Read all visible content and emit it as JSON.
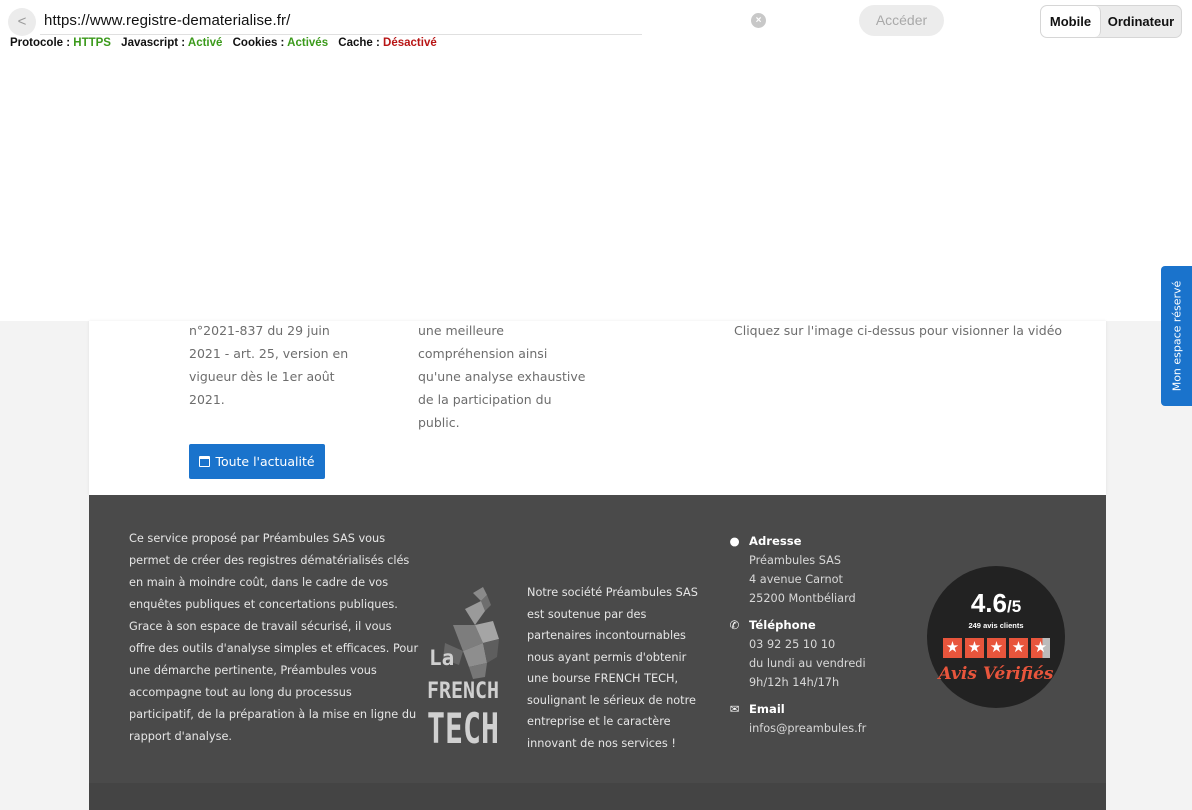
{
  "browser": {
    "back_label": "<",
    "url": "https://www.registre-dematerialise.fr/",
    "clear_label": "×",
    "go_label": "Accéder",
    "mode_mobile": "Mobile",
    "mode_desktop": "Ordinateur",
    "status": {
      "protocol_label": "Protocole :",
      "protocol_value": "HTTPS",
      "js_label": "Javascript :",
      "js_value": "Activé",
      "cookies_label": "Cookies :",
      "cookies_value": "Activés",
      "cache_label": "Cache :",
      "cache_value": "Désactivé"
    }
  },
  "content": {
    "col1_text": "n°2021-837 du 29 juin 2021 - art. 25, version en vigueur dès le 1er août 2021.",
    "col2_text": "une meilleure compréhension ainsi qu'une analyse exhaustive de la participation du public.",
    "video_caption": "Cliquez sur l'image ci-dessus pour visionner la vidéo",
    "news_button": "Toute l'actualité",
    "side_tab": "Mon espace réservé"
  },
  "footer": {
    "about": "Ce service proposé par Préambules SAS vous permet de créer des registres dématérialisés clés en main à moindre coût, dans le cadre de vos enquêtes publiques et concertations publiques. Grace à son espace de travail sécurisé, il vous offre des outils d'analyse simples et efficaces. Pour une démarche pertinente, Préambules vous accompagne tout au long du processus participatif, de la préparation à la mise en ligne du rapport d'analyse.",
    "frenchtech": {
      "line1": "La",
      "line2": "FRENCH",
      "line3": "TECH"
    },
    "support": "Notre société Préambules SAS est soutenue par des partenaires incontournables nous ayant permis d'obtenir une bourse FRENCH TECH, soulignant le sérieux de notre entreprise et le caractère innovant de nos services !",
    "address": {
      "heading": "Adresse",
      "line1": "Préambules SAS",
      "line2": "4 avenue Carnot",
      "line3": "25200 Montbéliard"
    },
    "phone": {
      "heading": "Téléphone",
      "line1": "03 92 25 10 10",
      "line2": "du lundi au vendredi",
      "line3": "9h/12h 14h/17h"
    },
    "email": {
      "heading": "Email",
      "line1": "infos@preambules.fr"
    },
    "rating": {
      "score": "4.6",
      "max": "/5",
      "count": "249 avis clients",
      "brand": "Avis Vérifiés",
      "stars": 4.6
    }
  }
}
